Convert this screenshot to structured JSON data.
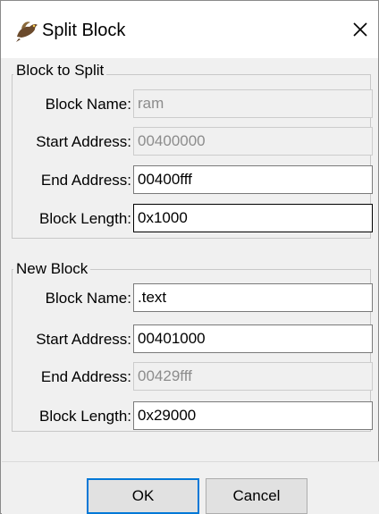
{
  "window": {
    "title": "Split Block",
    "icon": "dragon-icon",
    "close_glyph": "✕"
  },
  "block_to_split": {
    "legend": "Block to Split",
    "fields": [
      {
        "label": "Block Name:",
        "value": "ram",
        "enabled": false
      },
      {
        "label": "Start Address:",
        "value": "00400000",
        "enabled": false
      },
      {
        "label": "End Address:",
        "value": "00400fff",
        "enabled": true
      },
      {
        "label": "Block Length:",
        "value": "0x1000",
        "enabled": true,
        "focused": true
      }
    ]
  },
  "new_block": {
    "legend": "New Block",
    "fields": [
      {
        "label": "Block Name:",
        "value": ".text",
        "enabled": true
      },
      {
        "label": "Start Address:",
        "value": "00401000",
        "enabled": true
      },
      {
        "label": "End Address:",
        "value": "00429fff",
        "enabled": false
      },
      {
        "label": "Block Length:",
        "value": "0x29000",
        "enabled": true
      }
    ]
  },
  "buttons": {
    "ok_label": "OK",
    "cancel_label": "Cancel"
  },
  "colors": {
    "dialog_bg": "#f0f0f0",
    "focus_accent": "#0078d7",
    "disabled_text": "#8c8c8c"
  }
}
